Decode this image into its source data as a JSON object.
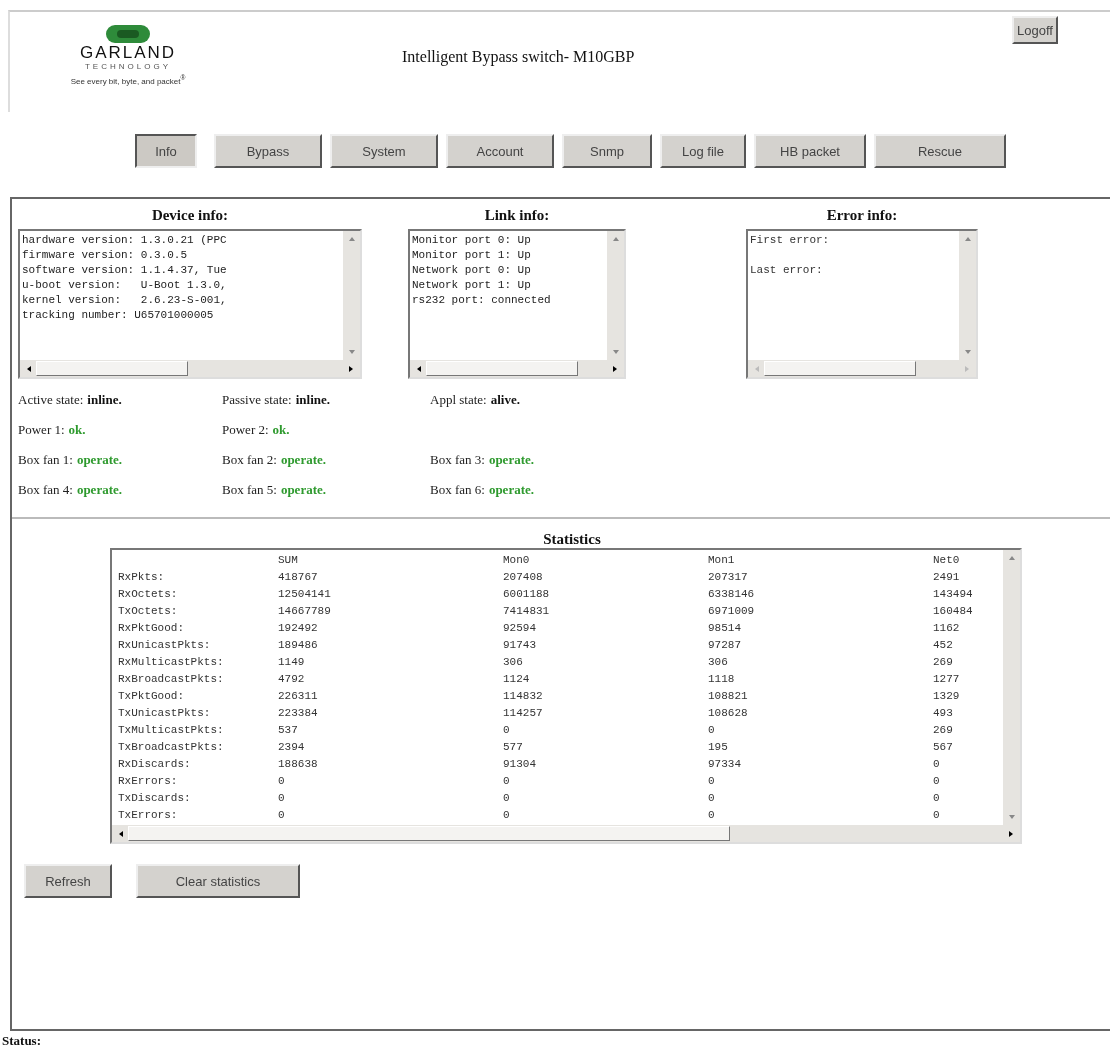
{
  "logo": {
    "name": "GARLAND",
    "subtitle": "TECHNOLOGY",
    "tagline": "See every bit, byte, and packet$^{®}$"
  },
  "title": "Intelligent Bypass switch- M10GBP",
  "logoff": "Logoff",
  "tabs": [
    {
      "label": "Info",
      "selected": true
    },
    {
      "label": "Bypass",
      "selected": false
    },
    {
      "label": "System",
      "selected": false
    },
    {
      "label": "Account",
      "selected": false
    },
    {
      "label": "Snmp",
      "selected": false
    },
    {
      "label": "Log file",
      "selected": false
    },
    {
      "label": "HB packet",
      "selected": false
    },
    {
      "label": "Rescue",
      "selected": false
    }
  ],
  "info_boxes": [
    {
      "heading": "Device info:",
      "lines": [
        "hardware version: 1.3.0.21 (PPC",
        "firmware version: 0.3.0.5",
        "software version: 1.1.4.37, Tue",
        "u-boot version:   U-Boot 1.3.0,",
        "kernel version:   2.6.23-S-001,",
        "tracking number: U65701000005"
      ],
      "disabled": false
    },
    {
      "heading": "Link info:",
      "lines": [
        "Monitor port 0: Up",
        "Monitor port 1: Up",
        "Network port 0: Up",
        "Network port 1: Up",
        "rs232 port: connected"
      ],
      "disabled": false
    },
    {
      "heading": "Error info:",
      "lines": [
        "First error:",
        "Last error:"
      ],
      "spaced": true,
      "disabled": true
    }
  ],
  "states": [
    [
      {
        "label": "Active state:",
        "value": "inline.",
        "kind": "neutral"
      },
      {
        "label": "Passive state:",
        "value": "inline.",
        "kind": "neutral"
      },
      {
        "label": "Appl state:",
        "value": "alive.",
        "kind": "neutral"
      }
    ],
    [
      {
        "label": "Power 1:",
        "value": "ok.",
        "kind": "good"
      },
      {
        "label": "Power 2:",
        "value": "ok.",
        "kind": "good"
      }
    ],
    [
      {
        "label": "Box fan 1:",
        "value": "operate.",
        "kind": "good"
      },
      {
        "label": "Box fan 2:",
        "value": "operate.",
        "kind": "good"
      },
      {
        "label": "Box fan 3:",
        "value": "operate.",
        "kind": "good"
      }
    ],
    [
      {
        "label": "Box fan 4:",
        "value": "operate.",
        "kind": "good"
      },
      {
        "label": "Box fan 5:",
        "value": "operate.",
        "kind": "good"
      },
      {
        "label": "Box fan 6:",
        "value": "operate.",
        "kind": "good"
      }
    ]
  ],
  "statistics": {
    "heading": "Statistics",
    "columns": [
      "",
      "SUM",
      "Mon0",
      "Mon1",
      "Net0"
    ],
    "rows": [
      [
        "RxPkts:",
        "418767",
        "207408",
        "207317",
        "2491"
      ],
      [
        "RxOctets:",
        "12504141",
        "6001188",
        "6338146",
        "143494"
      ],
      [
        "TxOctets:",
        "14667789",
        "7414831",
        "6971009",
        "160484"
      ],
      [
        "RxPktGood:",
        "192492",
        "92594",
        "98514",
        "1162"
      ],
      [
        "RxUnicastPkts:",
        "189486",
        "91743",
        "97287",
        "452"
      ],
      [
        "RxMulticastPkts:",
        "1149",
        "306",
        "306",
        "269"
      ],
      [
        "RxBroadcastPkts:",
        "4792",
        "1124",
        "1118",
        "1277"
      ],
      [
        "TxPktGood:",
        "226311",
        "114832",
        "108821",
        "1329"
      ],
      [
        "TxUnicastPkts:",
        "223384",
        "114257",
        "108628",
        "493"
      ],
      [
        "TxMulticastPkts:",
        "537",
        "0",
        "0",
        "269"
      ],
      [
        "TxBroadcastPkts:",
        "2394",
        "577",
        "195",
        "567"
      ],
      [
        "RxDiscards:",
        "188638",
        "91304",
        "97334",
        "0"
      ],
      [
        "RxErrors:",
        "0",
        "0",
        "0",
        "0"
      ],
      [
        "TxDiscards:",
        "0",
        "0",
        "0",
        "0"
      ],
      [
        "TxErrors:",
        "0",
        "0",
        "0",
        "0"
      ]
    ]
  },
  "buttons": [
    "Refresh",
    "Clear statistics"
  ],
  "status_label": "Status:"
}
